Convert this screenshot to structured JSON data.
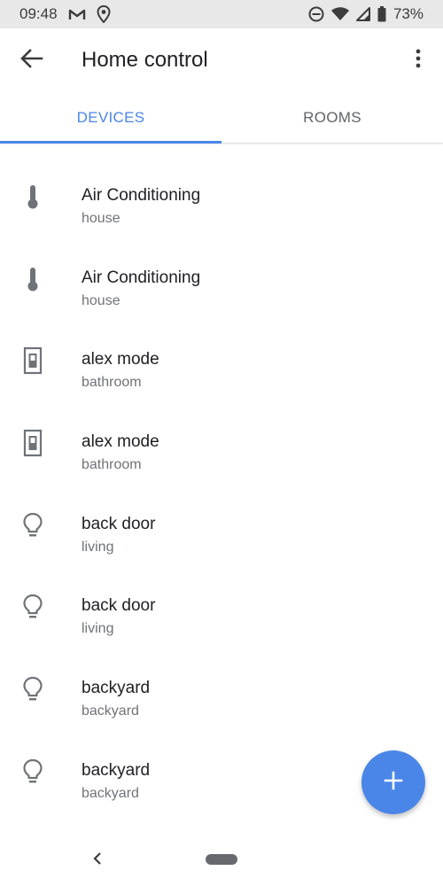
{
  "status_bar": {
    "time": "09:48",
    "battery": "73%",
    "icons": [
      "gmail-icon",
      "location-icon",
      "do-not-disturb-icon",
      "wifi-icon",
      "signal-icon",
      "battery-icon"
    ]
  },
  "app_bar": {
    "title": "Home control",
    "back_icon": "arrow-back-icon",
    "menu_icon": "more-vert-icon"
  },
  "tabs": [
    {
      "label": "DEVICES",
      "active": true
    },
    {
      "label": "ROOMS",
      "active": false
    }
  ],
  "devices": [
    {
      "name": "Air Conditioning",
      "room": "house",
      "icon": "thermometer-icon"
    },
    {
      "name": "Air Conditioning",
      "room": "house",
      "icon": "thermometer-icon"
    },
    {
      "name": "alex mode",
      "room": "bathroom",
      "icon": "switch-icon"
    },
    {
      "name": "alex mode",
      "room": "bathroom",
      "icon": "switch-icon"
    },
    {
      "name": "back door",
      "room": "living",
      "icon": "lightbulb-icon"
    },
    {
      "name": "back door",
      "room": "living",
      "icon": "lightbulb-icon"
    },
    {
      "name": "backyard",
      "room": "backyard",
      "icon": "lightbulb-icon"
    },
    {
      "name": "backyard",
      "room": "backyard",
      "icon": "lightbulb-icon"
    }
  ],
  "fab": {
    "icon": "add-icon"
  },
  "colors": {
    "accent": "#4a86e8",
    "icon_gray": "#6f7378"
  }
}
